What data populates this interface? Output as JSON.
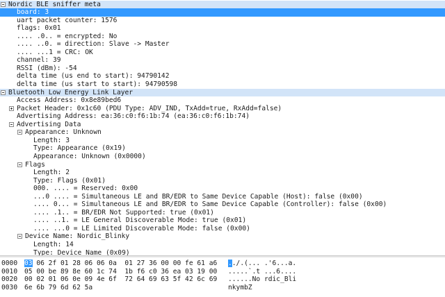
{
  "tree": [
    {
      "indent": 0,
      "toggle": "minus",
      "style": "hdr",
      "text": "Nordic BLE sniffer meta"
    },
    {
      "indent": 1,
      "toggle": "",
      "style": "sel",
      "text": "board: 3"
    },
    {
      "indent": 1,
      "toggle": "",
      "style": "",
      "text": "uart packet counter: 1576"
    },
    {
      "indent": 1,
      "toggle": "",
      "style": "",
      "text": "flags: 0x01"
    },
    {
      "indent": 1,
      "toggle": "",
      "style": "",
      "text": ".... .0.. = encrypted: No"
    },
    {
      "indent": 1,
      "toggle": "",
      "style": "",
      "text": ".... ..0. = direction: Slave -> Master"
    },
    {
      "indent": 1,
      "toggle": "",
      "style": "",
      "text": ".... ...1 = CRC: OK"
    },
    {
      "indent": 1,
      "toggle": "",
      "style": "",
      "text": "channel: 39"
    },
    {
      "indent": 1,
      "toggle": "",
      "style": "",
      "text": "RSSI (dBm): -54"
    },
    {
      "indent": 1,
      "toggle": "",
      "style": "",
      "text": "delta time (us end to start): 94790142"
    },
    {
      "indent": 1,
      "toggle": "",
      "style": "",
      "text": "delta time (us start to start): 94790598"
    },
    {
      "indent": 0,
      "toggle": "minus",
      "style": "hdr",
      "text": "Bluetooth Low Energy Link Layer"
    },
    {
      "indent": 1,
      "toggle": "",
      "style": "",
      "text": "Access Address: 0x8e89bed6"
    },
    {
      "indent": 1,
      "toggle": "plus",
      "style": "",
      "text": "Packet Header: 0x1c60 (PDU Type: ADV_IND, TxAdd=true, RxAdd=false)"
    },
    {
      "indent": 1,
      "toggle": "",
      "style": "",
      "text": "Advertising Address: ea:36:c0:f6:1b:74 (ea:36:c0:f6:1b:74)"
    },
    {
      "indent": 1,
      "toggle": "minus",
      "style": "",
      "text": "Advertising Data"
    },
    {
      "indent": 2,
      "toggle": "minus",
      "style": "",
      "text": "Appearance: Unknown"
    },
    {
      "indent": 3,
      "toggle": "",
      "style": "",
      "text": "Length: 3"
    },
    {
      "indent": 3,
      "toggle": "",
      "style": "",
      "text": "Type: Appearance (0x19)"
    },
    {
      "indent": 3,
      "toggle": "",
      "style": "",
      "text": "Appearance: Unknown (0x0000)"
    },
    {
      "indent": 2,
      "toggle": "minus",
      "style": "",
      "text": "Flags"
    },
    {
      "indent": 3,
      "toggle": "",
      "style": "",
      "text": "Length: 2"
    },
    {
      "indent": 3,
      "toggle": "",
      "style": "",
      "text": "Type: Flags (0x01)"
    },
    {
      "indent": 3,
      "toggle": "",
      "style": "",
      "text": "000. .... = Reserved: 0x00"
    },
    {
      "indent": 3,
      "toggle": "",
      "style": "",
      "text": "...0 .... = Simultaneous LE and BR/EDR to Same Device Capable (Host): false (0x00)"
    },
    {
      "indent": 3,
      "toggle": "",
      "style": "",
      "text": ".... 0... = Simultaneous LE and BR/EDR to Same Device Capable (Controller): false (0x00)"
    },
    {
      "indent": 3,
      "toggle": "",
      "style": "",
      "text": ".... .1.. = BR/EDR Not Supported: true (0x01)"
    },
    {
      "indent": 3,
      "toggle": "",
      "style": "",
      "text": ".... ..1. = LE General Discoverable Mode: true (0x01)"
    },
    {
      "indent": 3,
      "toggle": "",
      "style": "",
      "text": ".... ...0 = LE Limited Discoverable Mode: false (0x00)"
    },
    {
      "indent": 2,
      "toggle": "minus",
      "style": "",
      "text": "Device Name: Nordic_Blinky"
    },
    {
      "indent": 3,
      "toggle": "",
      "style": "",
      "text": "Length: 14"
    },
    {
      "indent": 3,
      "toggle": "",
      "style": "",
      "text": "Type: Device Name (0x09)"
    }
  ],
  "hex": [
    {
      "offset": "0000",
      "first_byte": "03",
      "bytes_rest": " 06 2f 01 28 06 06 0a  01 27 36 00 00 fe 61 a6",
      "first_char": ".",
      "ascii_rest": "./.(... .'6...a."
    },
    {
      "offset": "0010",
      "first_byte": "",
      "bytes_rest": "05 00 be 89 8e 60 1c 74  1b f6 c0 36 ea 03 19 00",
      "first_char": "",
      "ascii_rest": ".....`.t ...6...."
    },
    {
      "offset": "0020",
      "first_byte": "",
      "bytes_rest": "00 02 01 06 0e 09 4e 6f  72 64 69 63 5f 42 6c 69",
      "first_char": "",
      "ascii_rest": "......No rdic_Bli"
    },
    {
      "offset": "0030",
      "first_byte": "",
      "bytes_rest": "6e 6b 79 6d 62 5a",
      "first_char": "",
      "ascii_rest": "nkymbZ"
    }
  ],
  "colors": {
    "selection": "#3399ff",
    "header_band": "#d2e4f8"
  }
}
